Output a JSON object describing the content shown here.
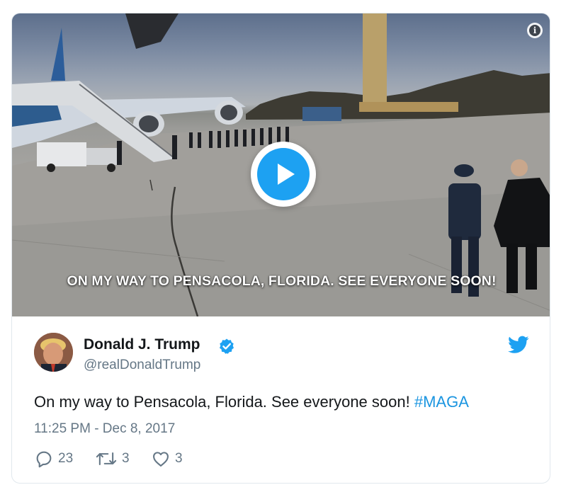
{
  "media": {
    "caption": "ON MY WAY TO PENSACOLA, FLORIDA. SEE EVERYONE SOON!",
    "play_icon": "play-icon",
    "info_icon": "info-icon"
  },
  "author": {
    "name": "Donald J. Trump",
    "handle": "@realDonaldTrump",
    "verified_icon": "verified-badge-icon"
  },
  "brand_icon": "twitter-bird-icon",
  "tweet": {
    "text": "On my way to Pensacola, Florida. See everyone soon! ",
    "hashtag": "#MAGA",
    "timestamp": "11:25 PM - Dec 8, 2017"
  },
  "actions": {
    "replies": "23",
    "retweets": "3",
    "likes": "3"
  },
  "colors": {
    "accent": "#1da1f2",
    "hashtag": "#1b95e0",
    "secondary_text": "#657786",
    "border": "#e1e8ed"
  }
}
